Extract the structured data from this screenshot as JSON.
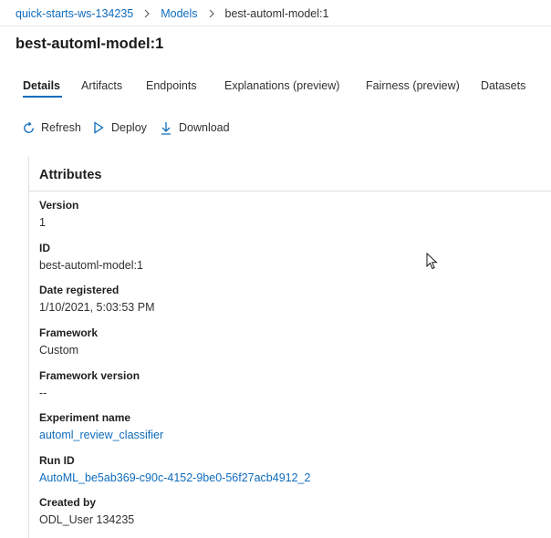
{
  "breadcrumb": {
    "workspace": "quick-starts-ws-134235",
    "models": "Models",
    "current": "best-automl-model:1"
  },
  "page": {
    "title": "best-automl-model:1"
  },
  "tabs": [
    {
      "label": "Details",
      "active": true
    },
    {
      "label": "Artifacts"
    },
    {
      "label": "Endpoints"
    },
    {
      "label": "Explanations (preview)"
    },
    {
      "label": "Fairness (preview)"
    },
    {
      "label": "Datasets"
    }
  ],
  "toolbar": {
    "refresh": {
      "label": "Refresh",
      "icon": "refresh-icon"
    },
    "deploy": {
      "label": "Deploy",
      "icon": "play-icon"
    },
    "download": {
      "label": "Download",
      "icon": "download-icon"
    }
  },
  "attributes": {
    "heading": "Attributes",
    "items": [
      {
        "label": "Version",
        "value": "1"
      },
      {
        "label": "ID",
        "value": "best-automl-model:1"
      },
      {
        "label": "Date registered",
        "value": "1/10/2021, 5:03:53 PM"
      },
      {
        "label": "Framework",
        "value": "Custom"
      },
      {
        "label": "Framework version",
        "value": "--"
      },
      {
        "label": "Experiment name",
        "value": "automl_review_classifier",
        "link": true
      },
      {
        "label": "Run ID",
        "value": "AutoML_be5ab369-c90c-4152-9be0-56f27acb4912_2",
        "link": true
      },
      {
        "label": "Created by",
        "value": "ODL_User 134235"
      }
    ]
  },
  "colors": {
    "accent": "#0f6cbd",
    "text": "#323130",
    "divider": "#e1dfdd"
  }
}
